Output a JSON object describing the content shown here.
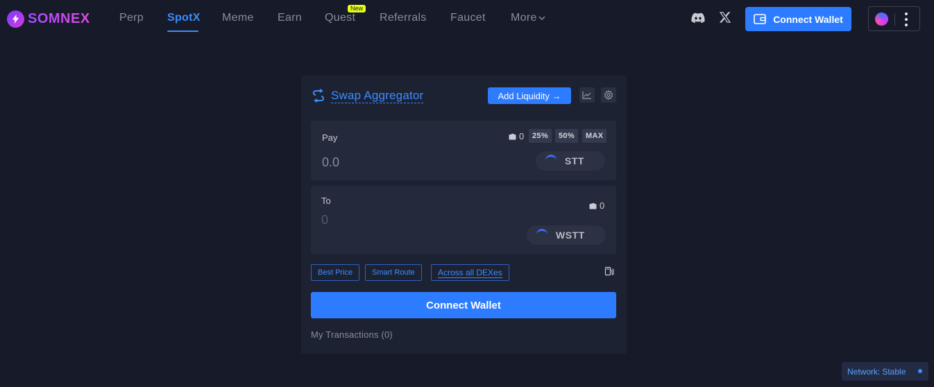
{
  "brand": {
    "name": "SOMNEX"
  },
  "nav": {
    "items": [
      {
        "label": "Perp"
      },
      {
        "label": "SpotX"
      },
      {
        "label": "Meme"
      },
      {
        "label": "Earn"
      },
      {
        "label": "Quest",
        "badge": "New"
      },
      {
        "label": "Referrals"
      },
      {
        "label": "Faucet"
      },
      {
        "label": "More"
      }
    ],
    "active": "SpotX"
  },
  "header": {
    "connect_label": "Connect Wallet",
    "social_icons": [
      "discord-icon",
      "x-icon"
    ]
  },
  "swap": {
    "title": "Swap Aggregator",
    "add_liquidity_label": "Add Liquidity →",
    "pay": {
      "label": "Pay",
      "amount": "0.0",
      "balance": "0",
      "percent_buttons": [
        "25%",
        "50%",
        "MAX"
      ],
      "token": "STT"
    },
    "to": {
      "label": "To",
      "amount": "0",
      "balance": "0",
      "token": "WSTT"
    },
    "tags": [
      "Best Price",
      "Smart Route",
      "Across all DEXes"
    ],
    "connect_label": "Connect Wallet",
    "transactions_label": "My Transactions (0)"
  },
  "network": {
    "label": "Network:",
    "status": "Stable"
  },
  "colors": {
    "accent": "#2d7cff",
    "background": "#161a29",
    "card": "#1d2232",
    "badge": "#e6ff1a"
  }
}
